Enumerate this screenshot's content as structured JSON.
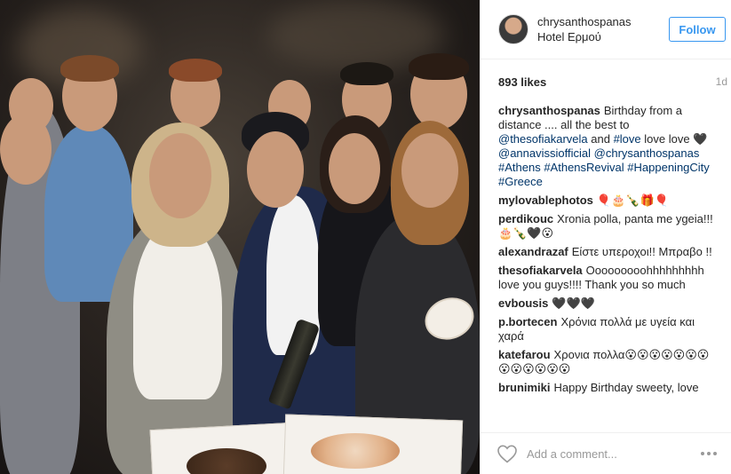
{
  "post": {
    "header": {
      "username": "chrysanthospanas",
      "location": "Hotel Ερμού",
      "follow_label": "Follow"
    },
    "stats": {
      "likes": "893 likes",
      "time": "1d"
    },
    "comments": [
      {
        "user": "chrysanthospanas",
        "parts": [
          {
            "t": "text",
            "v": "Birthday from a distance .... all the best to "
          },
          {
            "t": "link",
            "v": "@thesofiakarvela"
          },
          {
            "t": "text",
            "v": " and "
          },
          {
            "t": "link",
            "v": "#love"
          },
          {
            "t": "text",
            "v": " love love 🖤 "
          },
          {
            "t": "link",
            "v": "@annavissiofficial"
          },
          {
            "t": "text",
            "v": " "
          },
          {
            "t": "link",
            "v": "@chrysanthospanas"
          },
          {
            "t": "text",
            "v": " "
          },
          {
            "t": "link",
            "v": "#Athens"
          },
          {
            "t": "text",
            "v": " "
          },
          {
            "t": "link",
            "v": "#AthensRevival"
          },
          {
            "t": "text",
            "v": " "
          },
          {
            "t": "link",
            "v": "#HappeningCity"
          },
          {
            "t": "text",
            "v": " "
          },
          {
            "t": "link",
            "v": "#Greece"
          }
        ]
      },
      {
        "user": "mylovablephotos",
        "parts": [
          {
            "t": "text",
            "v": "🎈🎂🍾🎁🎈"
          }
        ]
      },
      {
        "user": "perdikouc",
        "parts": [
          {
            "t": "text",
            "v": "Xronia polla, panta me ygeia!!!🎂🍾🖤😮"
          }
        ]
      },
      {
        "user": "alexandrazaf",
        "parts": [
          {
            "t": "text",
            "v": "Είστε υπεροχοι!! Μπραβο !!"
          }
        ]
      },
      {
        "user": "thesofiakarvela",
        "parts": [
          {
            "t": "text",
            "v": "Ooooooooohhhhhhhhh love you guys!!!! Thank you so much"
          }
        ]
      },
      {
        "user": "evbousis",
        "parts": [
          {
            "t": "text",
            "v": "🖤🖤🖤"
          }
        ]
      },
      {
        "user": "p.bortecen",
        "parts": [
          {
            "t": "text",
            "v": "Χρόνια πολλά με υγεία και χαρά"
          }
        ]
      },
      {
        "user": "katefarou",
        "parts": [
          {
            "t": "text",
            "v": "Χρονια πολλα😮😮😮😮😮😮😮😮😮😮😮😮😮"
          }
        ]
      },
      {
        "user": "brunimiki",
        "parts": [
          {
            "t": "text",
            "v": "Happy Birthday sweety, love"
          }
        ]
      }
    ],
    "footer": {
      "add_comment_placeholder": "Add a comment..."
    }
  },
  "icons": {
    "like": "heart-icon",
    "more": "more-options-icon"
  },
  "colors": {
    "follow_blue": "#3897f0",
    "link_blue": "#003569",
    "muted": "#999999"
  }
}
